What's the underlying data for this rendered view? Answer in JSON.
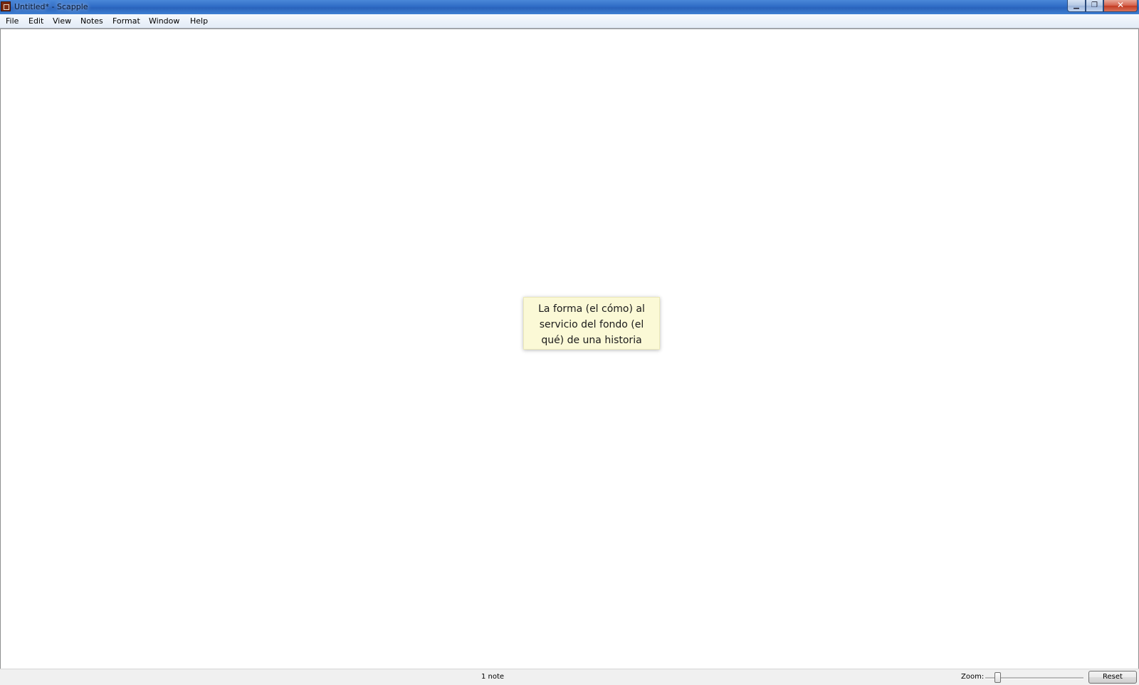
{
  "window": {
    "title": "Untitled* - Scapple",
    "controls": {
      "minimize_glyph": "▁",
      "maximize_glyph": "❐",
      "close_glyph": "✕"
    }
  },
  "menubar": {
    "items": [
      "File",
      "Edit",
      "View",
      "Notes",
      "Format",
      "Window",
      "Help"
    ]
  },
  "canvas": {
    "notes": [
      {
        "lines": [
          "La forma (el cómo) al",
          "servicio del fondo (el",
          "qué) de una historia"
        ],
        "background": "#fbf9d6"
      }
    ]
  },
  "statusbar": {
    "note_count": "1 note",
    "zoom_label": "Zoom:",
    "reset_label": "Reset"
  },
  "colors": {
    "titlebar_accent": "#2f6cc6",
    "note_background": "#fbf9d6"
  }
}
